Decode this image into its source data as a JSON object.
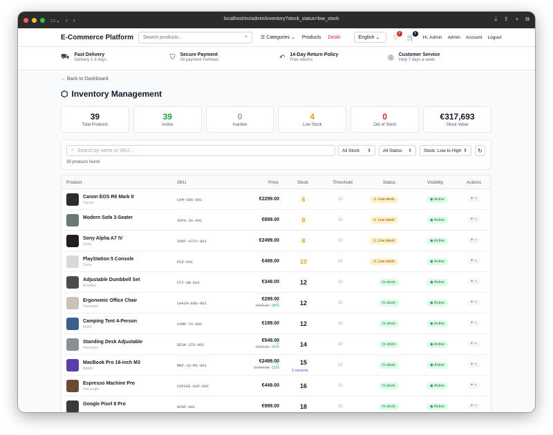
{
  "browser": {
    "url": "localhost/en/admin/inventory?stock_status=low_stock"
  },
  "header": {
    "brand": "E-Commerce Platform",
    "search_placeholder": "Search products...",
    "categories": "Categories",
    "products": "Products",
    "deals": "Deals",
    "language": "English",
    "wishlist_count": "2",
    "cart_count": "5",
    "greeting": "Hi, Admin",
    "admin": "Admin",
    "account": "Account",
    "logout": "Logout"
  },
  "benefits": [
    {
      "title": "Fast Delivery",
      "sub": "Delivery 1-3 days",
      "icon": "truck-icon"
    },
    {
      "title": "Secure Payment",
      "sub": "All payment methods",
      "icon": "shield-icon"
    },
    {
      "title": "14-Day Return Policy",
      "sub": "Free returns",
      "icon": "return-icon"
    },
    {
      "title": "Customer Service",
      "sub": "Help 7 days a week",
      "icon": "support-icon"
    }
  ],
  "page": {
    "back": "Back to Dashboard",
    "title": "Inventory Management"
  },
  "stats": [
    {
      "value": "39",
      "label": "Total Products",
      "color": "#111827"
    },
    {
      "value": "39",
      "label": "Active",
      "color": "#16a34a"
    },
    {
      "value": "0",
      "label": "Inactive",
      "color": "#9ca3af"
    },
    {
      "value": "4",
      "label": "Low Stock",
      "color": "#f59e0b"
    },
    {
      "value": "0",
      "label": "Out of Stock",
      "color": "#dc2626"
    },
    {
      "value": "€317,693",
      "label": "Stock Value",
      "color": "#111827"
    }
  ],
  "filters": {
    "search_placeholder": "Search by name or SKU...",
    "stock": "All Stock",
    "status": "All Status",
    "sort": "Stock: Low to High",
    "count": "39 products found"
  },
  "table": {
    "headers": {
      "product": "Product",
      "sku": "SKU",
      "price": "Price",
      "stock": "Stock",
      "threshold": "Threshold",
      "status": "Status",
      "visibility": "Visibility",
      "actions": "Actions"
    },
    "rows": [
      {
        "name": "Canon EOS R6 Mark II",
        "brand": "Canon",
        "sku": "CAM-CR6-001",
        "price": "€2299.00",
        "old": "",
        "discount": "",
        "stock": "6",
        "stock_color": "#f59e0b",
        "variants": "",
        "threshold": "10",
        "status": "Low stock",
        "status_type": "low",
        "visibility": "Active",
        "thumb": "#2d2d2d"
      },
      {
        "name": "Modern Sofa 3-Seater",
        "brand": "",
        "sku": "SOFA-3S-001",
        "price": "€899.00",
        "old": "",
        "discount": "",
        "stock": "8",
        "stock_color": "#f59e0b",
        "variants": "",
        "threshold": "10",
        "status": "Low stock",
        "status_type": "low",
        "visibility": "Active",
        "thumb": "#6b7a70"
      },
      {
        "name": "Sony Alpha A7 IV",
        "brand": "Sony",
        "sku": "SONY-A7IV-001",
        "price": "€2499.00",
        "old": "",
        "discount": "",
        "stock": "8",
        "stock_color": "#f59e0b",
        "variants": "",
        "threshold": "10",
        "status": "Low stock",
        "status_type": "low",
        "visibility": "Active",
        "thumb": "#1f1f1f"
      },
      {
        "name": "PlayStation 5 Console",
        "brand": "Sony",
        "sku": "PS5-001",
        "price": "€499.00",
        "old": "",
        "discount": "",
        "stock": "10",
        "stock_color": "#f59e0b",
        "variants": "",
        "threshold": "10",
        "status": "Low stock",
        "status_type": "low",
        "visibility": "Active",
        "thumb": "#d9d9d9"
      },
      {
        "name": "Adjustable Dumbbell Set",
        "brand": "Bowflex",
        "sku": "FIT-DB-001",
        "price": "€349.00",
        "old": "",
        "discount": "",
        "stock": "12",
        "stock_color": "#111827",
        "variants": "",
        "threshold": "10",
        "status": "In stock",
        "status_type": "in",
        "visibility": "Active",
        "thumb": "#4b4b4b"
      },
      {
        "name": "Ergonomic Office Chair",
        "brand": "Flexispot",
        "sku": "CHAIR-ERG-001",
        "price": "€299.00",
        "old": "€399.00",
        "discount": "-25%",
        "stock": "12",
        "stock_color": "#111827",
        "variants": "",
        "threshold": "10",
        "status": "In stock",
        "status_type": "in",
        "visibility": "Active",
        "thumb": "#c9c2b8"
      },
      {
        "name": "Camping Tent 4-Person",
        "brand": "MSR",
        "sku": "CAMP-T4-001",
        "price": "€199.00",
        "old": "",
        "discount": "",
        "stock": "12",
        "stock_color": "#111827",
        "variants": "",
        "threshold": "10",
        "status": "In stock",
        "status_type": "in",
        "visibility": "Active",
        "thumb": "#3b5f8a"
      },
      {
        "name": "Standing Desk Adjustable",
        "brand": "Flexispot",
        "sku": "DESK-STD-001",
        "price": "€549.00",
        "old": "€699.00",
        "discount": "-21%",
        "stock": "14",
        "stock_color": "#111827",
        "variants": "",
        "threshold": "10",
        "status": "In stock",
        "status_type": "in",
        "visibility": "Active",
        "thumb": "#8a8f96"
      },
      {
        "name": "MacBook Pro 16-inch M3",
        "brand": "Apple",
        "sku": "MBP-16-M3-001",
        "price": "€2499.00",
        "old": "€2799.00",
        "discount": "-11%",
        "stock": "15",
        "stock_color": "#111827",
        "variants": "3 variants",
        "threshold": "10",
        "status": "In stock",
        "status_type": "in",
        "visibility": "Active",
        "thumb": "#5b3fa8"
      },
      {
        "name": "Espresso Machine Pro",
        "brand": "DeLonghi",
        "sku": "COFFEE-ESP-001",
        "price": "€449.00",
        "old": "",
        "discount": "",
        "stock": "16",
        "stock_color": "#111827",
        "variants": "",
        "threshold": "10",
        "status": "In stock",
        "status_type": "in",
        "visibility": "Active",
        "thumb": "#6b4a33"
      },
      {
        "name": "Google Pixel 8 Pro",
        "brand": "",
        "sku": "GP8P-001",
        "price": "€999.00",
        "old": "",
        "discount": "",
        "stock": "18",
        "stock_color": "#111827",
        "variants": "",
        "threshold": "10",
        "status": "In stock",
        "status_type": "in",
        "visibility": "Active",
        "thumb": "#3a3a3a"
      }
    ]
  }
}
